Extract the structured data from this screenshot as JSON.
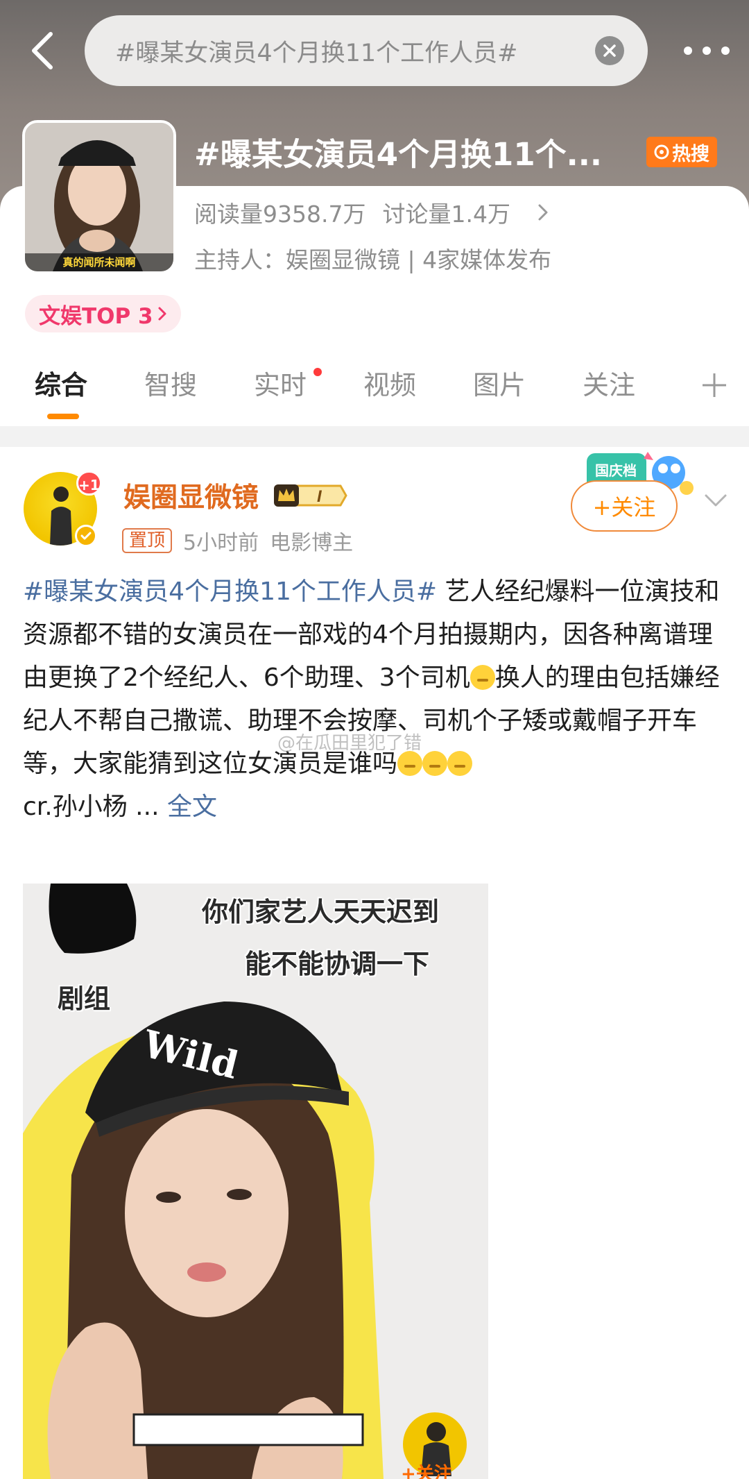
{
  "search": {
    "query": "#曝某女演员4个月换11个工作人员#"
  },
  "topic": {
    "title": "#曝某女演员4个月换11个...",
    "hot_label": "热搜",
    "reads": "阅读量9358.7万",
    "discussions": "讨论量1.4万",
    "host": "主持人：娱圈显微镜 | 4家媒体发布",
    "thumb_caption": "真的闻所未闻啊",
    "rank_label": "文娱TOP 3"
  },
  "tabs": [
    "综合",
    "智搜",
    "实时",
    "视频",
    "图片",
    "关注"
  ],
  "post": {
    "author": "娱圈显微镜",
    "notif_count": "+1",
    "vip_level": "I",
    "pin_label": "置顶",
    "time": "5小时前",
    "author_role": "电影博主",
    "follow_label": "+关注",
    "hashtag": "#曝某女演员4个月换11个工作人员#",
    "text_1": " 艺人经纪爆料一位演技和资源都不错的女演员在一部戏的4个月拍摄期内，因各种离谱理由更换了2个经纪人、6个助理、3个司机",
    "text_2": "换人的理由包括嫌经纪人不帮自己撒谎、助理不会按摩、司机个子矮或戴帽子开车等，大家能猜到这位女演员是谁吗",
    "credit": "cr.孙小杨 ...",
    "read_more": "全文",
    "watermark": "@在瓜田里犯了错",
    "sticker_text": "国庆档"
  },
  "image": {
    "caption_1": "你们家艺人天天迟到",
    "caption_2": "能不能协调一下",
    "caption_3": "剧组",
    "cap_text": "Wild",
    "follow_label": "+关注"
  },
  "colors": {
    "accent": "#ff8a00",
    "hashtag": "#4a6ea0",
    "author": "#e06a1f",
    "hot": "#ff7a1a",
    "rank": "#f0386b"
  }
}
